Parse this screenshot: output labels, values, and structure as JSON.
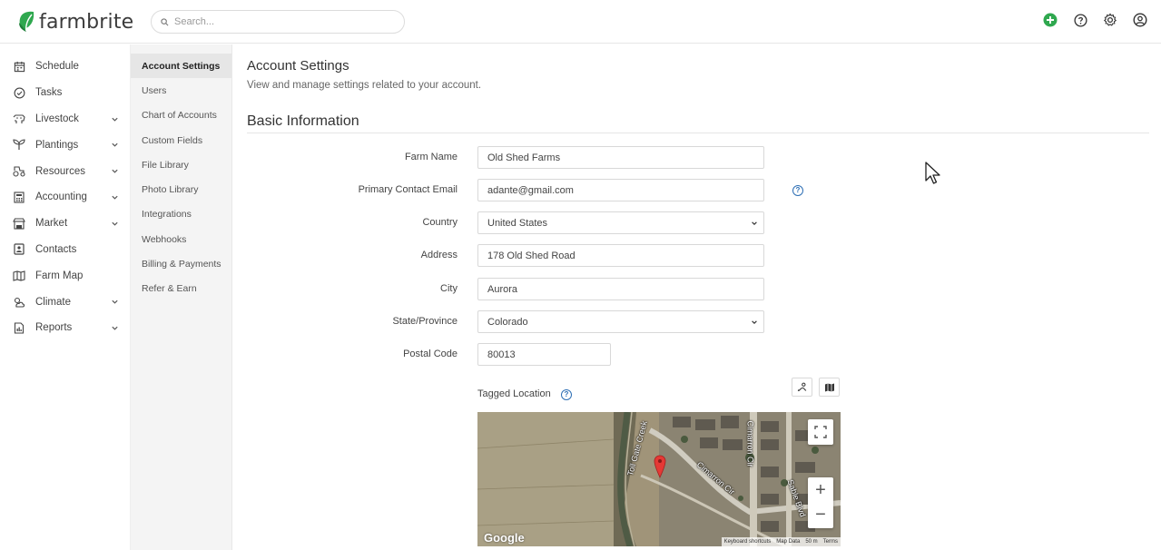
{
  "header": {
    "logo_text": "farmbrite",
    "search_placeholder": "Search...",
    "icons": [
      "add-icon",
      "help-icon",
      "settings-icon",
      "account-icon"
    ],
    "accent_color": "#2fa84f"
  },
  "sidebar": {
    "items": [
      {
        "label": "Schedule",
        "icon": "calendar-icon",
        "has_chevron": false
      },
      {
        "label": "Tasks",
        "icon": "check-circle-icon",
        "has_chevron": false
      },
      {
        "label": "Livestock",
        "icon": "livestock-icon",
        "has_chevron": true
      },
      {
        "label": "Plantings",
        "icon": "sprout-icon",
        "has_chevron": true
      },
      {
        "label": "Resources",
        "icon": "tractor-icon",
        "has_chevron": true
      },
      {
        "label": "Accounting",
        "icon": "calculator-icon",
        "has_chevron": true
      },
      {
        "label": "Market",
        "icon": "store-icon",
        "has_chevron": true
      },
      {
        "label": "Contacts",
        "icon": "contacts-icon",
        "has_chevron": false
      },
      {
        "label": "Farm Map",
        "icon": "map-icon",
        "has_chevron": false
      },
      {
        "label": "Climate",
        "icon": "weather-icon",
        "has_chevron": true
      },
      {
        "label": "Reports",
        "icon": "report-icon",
        "has_chevron": true
      }
    ]
  },
  "subnav": {
    "items": [
      {
        "label": "Account Settings",
        "active": true
      },
      {
        "label": "Users",
        "active": false
      },
      {
        "label": "Chart of Accounts",
        "active": false
      },
      {
        "label": "Custom Fields",
        "active": false
      },
      {
        "label": "File Library",
        "active": false
      },
      {
        "label": "Photo Library",
        "active": false
      },
      {
        "label": "Integrations",
        "active": false
      },
      {
        "label": "Webhooks",
        "active": false
      },
      {
        "label": "Billing & Payments",
        "active": false
      },
      {
        "label": "Refer & Earn",
        "active": false
      }
    ]
  },
  "main": {
    "title": "Account Settings",
    "subtitle": "View and manage settings related to your account.",
    "section_title": "Basic Information",
    "form": {
      "farm_name": {
        "label": "Farm Name",
        "value": "Old Shed Farms"
      },
      "email": {
        "label": "Primary Contact Email",
        "value": "adante@gmail.com"
      },
      "country": {
        "label": "Country",
        "value": "United States"
      },
      "address": {
        "label": "Address",
        "value": "178 Old Shed Road"
      },
      "city": {
        "label": "City",
        "value": "Aurora"
      },
      "state": {
        "label": "State/Province",
        "value": "Colorado"
      },
      "postal": {
        "label": "Postal Code",
        "value": "80013"
      }
    },
    "tagged_location_label": "Tagged Location",
    "map": {
      "road_labels": [
        "Toll Gate Creek",
        "Cimarron Cir",
        "Cimarron Cir",
        "Sable Blvd"
      ],
      "google_label": "Google",
      "footer": [
        "Keyboard shortcuts",
        "Map Data",
        "50 m",
        "Terms"
      ],
      "zoom_in": "+",
      "zoom_out": "−"
    }
  }
}
